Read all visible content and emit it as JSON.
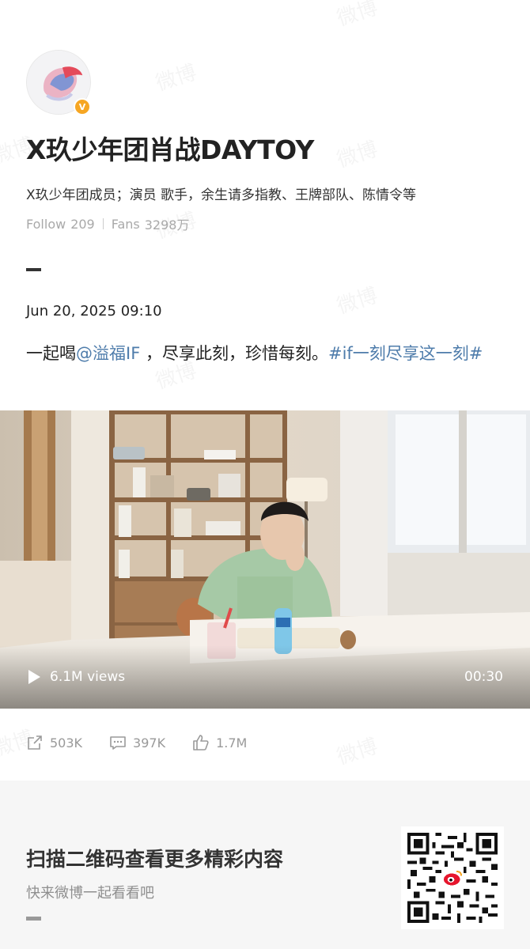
{
  "profile": {
    "name": "X玖少年团肖战DAYTOY",
    "bio": "X玖少年团成员；演员 歌手，余生请多指教、王牌部队、陈情令等",
    "follow_label": "Follow",
    "follow_count": "209",
    "fans_label": "Fans",
    "fans_count": "3298万",
    "verified_badge": "V"
  },
  "post": {
    "time": "Jun 20, 2025 09:10",
    "text_prefix": "一起喝",
    "mention": "@溢福IF",
    "text_middle": " ，尽享此刻，珍惜每刻。",
    "hashtag": "#if一刻尽享这一刻#"
  },
  "video": {
    "views": "6.1M views",
    "duration": "00:30"
  },
  "actions": {
    "share_count": "503K",
    "comment_count": "397K",
    "like_count": "1.7M"
  },
  "footer": {
    "title": "扫描二维码查看更多精彩内容",
    "subtitle": "快来微博一起看看吧"
  },
  "watermark_text": "微博",
  "colors": {
    "link": "#4e7cab",
    "badge": "#f6a623",
    "footer_bg": "#f6f6f6"
  },
  "icons": [
    "play-icon",
    "share-icon",
    "comment-icon",
    "like-icon",
    "weibo-logo-icon",
    "verified-icon"
  ]
}
